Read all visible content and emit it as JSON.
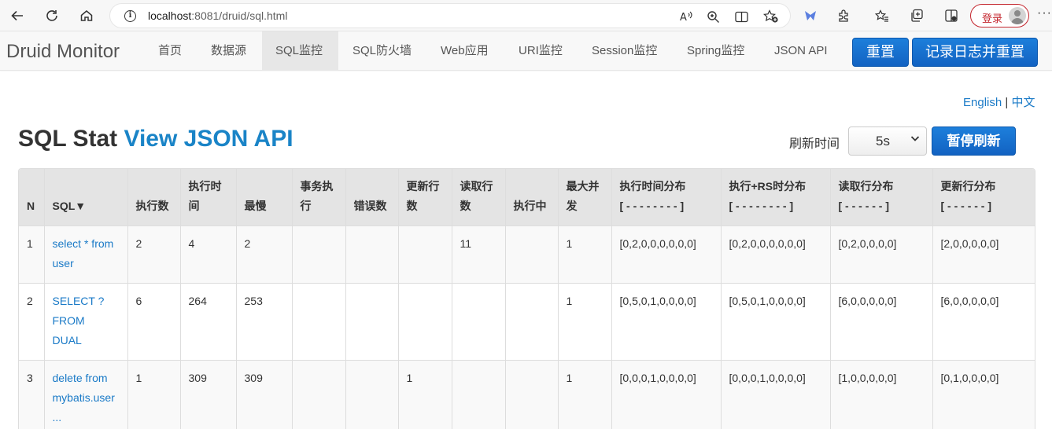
{
  "browser": {
    "url_host": "localhost",
    "url_path": ":8081/druid/sql.html",
    "login_label": "登录"
  },
  "navbar": {
    "brand": "Druid Monitor",
    "items": [
      {
        "label": "首页",
        "active": false
      },
      {
        "label": "数据源",
        "active": false
      },
      {
        "label": "SQL监控",
        "active": true
      },
      {
        "label": "SQL防火墙",
        "active": false
      },
      {
        "label": "Web应用",
        "active": false
      },
      {
        "label": "URI监控",
        "active": false
      },
      {
        "label": "Session监控",
        "active": false
      },
      {
        "label": "Spring监控",
        "active": false
      },
      {
        "label": "JSON API",
        "active": false
      }
    ],
    "reset_label": "重置",
    "log_reset_label": "记录日志并重置"
  },
  "lang": {
    "english": "English",
    "separator": "|",
    "chinese": "中文"
  },
  "page": {
    "title": "SQL Stat",
    "api_link": "View JSON API",
    "refresh_label": "刷新时间",
    "refresh_value": "5s",
    "pause_label": "暂停刷新"
  },
  "table": {
    "headers": [
      [
        "N"
      ],
      [
        "SQL▼"
      ],
      [
        "执行数"
      ],
      [
        "执行时",
        "间"
      ],
      [
        "最慢"
      ],
      [
        "事务执",
        "行"
      ],
      [
        "错误数"
      ],
      [
        "更新行",
        "数"
      ],
      [
        "读取行",
        "数"
      ],
      [
        "执行中"
      ],
      [
        "最大并",
        "发"
      ],
      [
        "执行时间分布",
        "[ - - - - - - - - ]"
      ],
      [
        "执行+RS时分布",
        "[ - - - - - - - - ]"
      ],
      [
        "读取行分布",
        "[ - - - - - - ]"
      ],
      [
        "更新行分布",
        "[ - - - - - - ]"
      ]
    ],
    "rows": [
      {
        "n": "1",
        "sql": [
          "select * from",
          "user"
        ],
        "cells": [
          "2",
          "4",
          "2",
          "",
          "",
          "",
          "11",
          "",
          "1",
          "[0,2,0,0,0,0,0,0]",
          "[0,2,0,0,0,0,0,0]",
          "[0,2,0,0,0,0]",
          "[2,0,0,0,0,0]"
        ]
      },
      {
        "n": "2",
        "sql": [
          "SELECT ?",
          "FROM",
          "DUAL"
        ],
        "cells": [
          "6",
          "264",
          "253",
          "",
          "",
          "",
          "",
          "",
          "1",
          "[0,5,0,1,0,0,0,0]",
          "[0,5,0,1,0,0,0,0]",
          "[6,0,0,0,0,0]",
          "[6,0,0,0,0,0]"
        ]
      },
      {
        "n": "3",
        "sql": [
          "delete from",
          "mybatis.user",
          "..."
        ],
        "cells": [
          "1",
          "309",
          "309",
          "",
          "",
          "1",
          "",
          "",
          "1",
          "[0,0,0,1,0,0,0,0]",
          "[0,0,0,1,0,0,0,0]",
          "[1,0,0,0,0,0]",
          "[0,1,0,0,0,0]"
        ]
      }
    ]
  }
}
